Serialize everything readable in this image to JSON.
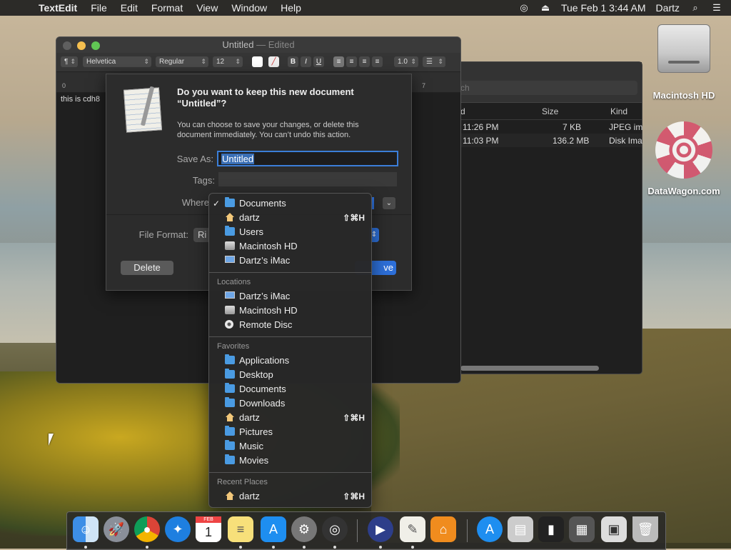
{
  "menubar": {
    "app": "TextEdit",
    "items": [
      "File",
      "Edit",
      "Format",
      "View",
      "Window",
      "Help"
    ],
    "datetime": "Tue Feb 1  3:44 AM",
    "user": "Dartz"
  },
  "textedit": {
    "title": "Untitled",
    "edited": "— Edited",
    "font_family": "Helvetica",
    "font_style": "Regular",
    "font_size": "12",
    "line_spacing": "1.0",
    "ruler_start": "0",
    "ruler_end": "7",
    "body_text": "this is cdh8"
  },
  "save_sheet": {
    "question": "Do you want to keep this new document “Untitled”?",
    "info": "You can choose to save your changes, or delete this document immediately. You can’t undo this action.",
    "save_as_label": "Save As:",
    "save_as_value": "Untitled",
    "tags_label": "Tags:",
    "where_label": "Where",
    "file_format_label": "File Format:",
    "file_format_value": "Ri",
    "delete_label": "Delete",
    "save_label": "ve"
  },
  "where_menu": {
    "top": [
      {
        "label": "Documents",
        "icon": "folder-icon",
        "checked": true,
        "shortcut": ""
      },
      {
        "label": "dartz",
        "icon": "home-icon",
        "checked": false,
        "shortcut": "⇧⌘H"
      },
      {
        "label": "Users",
        "icon": "folder-icon",
        "checked": false,
        "shortcut": ""
      },
      {
        "label": "Macintosh HD",
        "icon": "hard-drive-icon",
        "checked": false,
        "shortcut": ""
      },
      {
        "label": "Dartz’s iMac",
        "icon": "imac-icon",
        "checked": false,
        "shortcut": ""
      }
    ],
    "locations_header": "Locations",
    "locations": [
      {
        "label": "Dartz’s iMac",
        "icon": "imac-icon"
      },
      {
        "label": "Macintosh HD",
        "icon": "hard-drive-icon"
      },
      {
        "label": "Remote Disc",
        "icon": "disc-icon"
      }
    ],
    "favorites_header": "Favorites",
    "favorites": [
      {
        "label": "Applications",
        "icon": "folder-icon",
        "shortcut": ""
      },
      {
        "label": "Desktop",
        "icon": "folder-icon",
        "shortcut": ""
      },
      {
        "label": "Documents",
        "icon": "folder-icon",
        "shortcut": ""
      },
      {
        "label": "Downloads",
        "icon": "folder-icon",
        "shortcut": ""
      },
      {
        "label": "dartz",
        "icon": "home-icon",
        "shortcut": "⇧⌘H"
      },
      {
        "label": "Pictures",
        "icon": "folder-icon",
        "shortcut": ""
      },
      {
        "label": "Music",
        "icon": "folder-icon",
        "shortcut": ""
      },
      {
        "label": "Movies",
        "icon": "folder-icon",
        "shortcut": ""
      }
    ],
    "recent_header": "Recent Places",
    "recent": [
      {
        "label": "dartz",
        "icon": "home-icon",
        "shortcut": "⇧⌘H"
      }
    ]
  },
  "finder": {
    "search_placeholder": "ch",
    "col_date": "d",
    "col_size": "Size",
    "col_kind": "Kind",
    "rows": [
      {
        "date": "11:26 PM",
        "size": "7 KB",
        "kind": "JPEG im"
      },
      {
        "date": "11:03 PM",
        "size": "136.2 MB",
        "kind": "Disk Ima"
      }
    ]
  },
  "desktop": {
    "hd_label": "Macintosh HD",
    "datawagon_label": "DataWagon.com"
  },
  "dock": {
    "apps": [
      "finder-icon",
      "launchpad-icon",
      "chrome-icon",
      "safari-icon",
      "calendar-icon",
      "notes-icon",
      "app-store-icon",
      "system-preferences-icon",
      "obs-icon",
      "media-player-icon",
      "textedit-icon",
      "home-icon",
      "app-store-downloads-icon",
      "preview-icon",
      "terminal-icon",
      "screenshot-icon",
      "chrome-app-icon",
      "trash-icon"
    ],
    "calendar_month": "FEB",
    "calendar_day": "1"
  }
}
